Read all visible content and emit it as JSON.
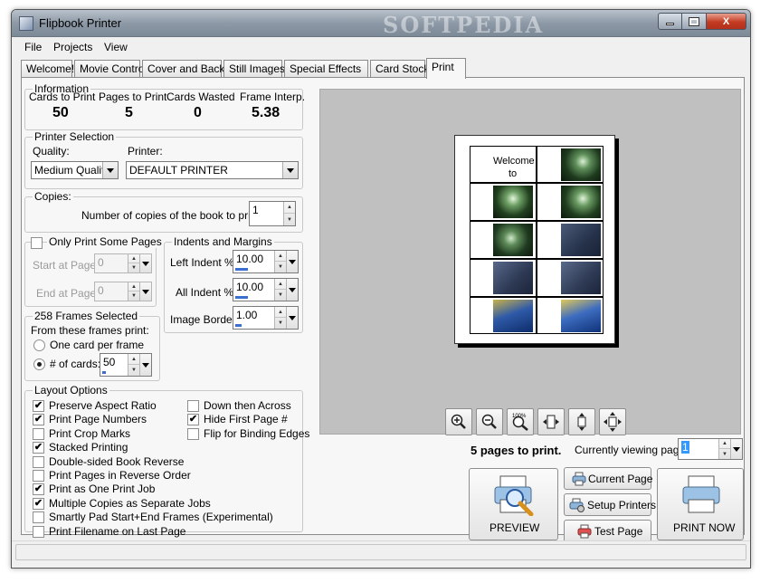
{
  "window": {
    "title": "Flipbook Printer",
    "watermark": "SOFTPEDIA",
    "close_glyph": "X"
  },
  "menu": [
    "File",
    "Projects",
    "View"
  ],
  "tabs": [
    "Welcome!",
    "Movie Control",
    "Cover and Back",
    "Still Images",
    "Special Effects",
    "Card Stock",
    "Print"
  ],
  "active_tab": "Print",
  "information": {
    "legend": "Information",
    "items": [
      {
        "label": "Cards to Print",
        "value": "50"
      },
      {
        "label": "Pages to Print",
        "value": "5"
      },
      {
        "label": "Cards Wasted",
        "value": "0"
      },
      {
        "label": "Frame Interp.",
        "value": "5.38"
      }
    ]
  },
  "printer_selection": {
    "legend": "Printer Selection",
    "quality_label": "Quality:",
    "quality_value": "Medium Quality",
    "printer_label": "Printer:",
    "printer_value": "DEFAULT PRINTER"
  },
  "copies": {
    "legend": "Copies:",
    "label": "Number of copies of the book to print:",
    "value": "1"
  },
  "only_print_some_pages": {
    "label": "Only Print Some Pages",
    "checked": false,
    "start_label": "Start at Page:",
    "start_value": "0",
    "end_label": "End at Page:",
    "end_value": "0"
  },
  "indents": {
    "legend": "Indents and Margins",
    "left_indent_label": "Left Indent %:",
    "left_indent_value": "10.00",
    "all_indent_label": "All Indent %:",
    "all_indent_value": "10.00",
    "image_border_label": "Image Border:",
    "image_border_value": "1.00"
  },
  "frames": {
    "legend": "258 Frames Selected",
    "from_label": "From these frames print:",
    "option_one": "One card per frame",
    "option_cards": "# of cards:",
    "selected": "# of cards:",
    "cards_value": "50"
  },
  "layout_options": {
    "legend": "Layout Options",
    "left": [
      {
        "label": "Preserve Aspect Ratio",
        "checked": true
      },
      {
        "label": "Print Page Numbers",
        "checked": true
      },
      {
        "label": "Print Crop Marks",
        "checked": false
      },
      {
        "label": "Stacked Printing",
        "checked": true
      },
      {
        "label": "Double-sided Book Reverse",
        "checked": false
      },
      {
        "label": "Print Pages in Reverse Order",
        "checked": false
      },
      {
        "label": "Print as One Print Job",
        "checked": true
      },
      {
        "label": "Multiple Copies as Separate Jobs",
        "checked": true
      },
      {
        "label": "Smartly Pad Start+End Frames (Experimental)",
        "checked": false
      },
      {
        "label": "Print Filename on Last Page",
        "checked": false
      }
    ],
    "right": [
      {
        "label": "Down then Across",
        "checked": false
      },
      {
        "label": "Hide First Page #",
        "checked": true
      },
      {
        "label": "Flip for Binding Edges",
        "checked": false
      }
    ]
  },
  "preview": {
    "welcome_line1": "Welcome",
    "welcome_line2": "to",
    "zoom_100_label": "100%"
  },
  "print_panel": {
    "pages_to_print_text": "5 pages to print.",
    "viewing_label": "Currently viewing page:",
    "viewing_value": "1",
    "preview_button": "PREVIEW",
    "current_page_button": "Current Page",
    "setup_printers_button": "Setup Printers",
    "test_page_button": "Test Page",
    "print_now_button": "PRINT NOW"
  },
  "colors": {
    "accent": "#3a6fd0",
    "preview_bg": "#c0c0c0",
    "titlebar": "#8d99a6"
  }
}
